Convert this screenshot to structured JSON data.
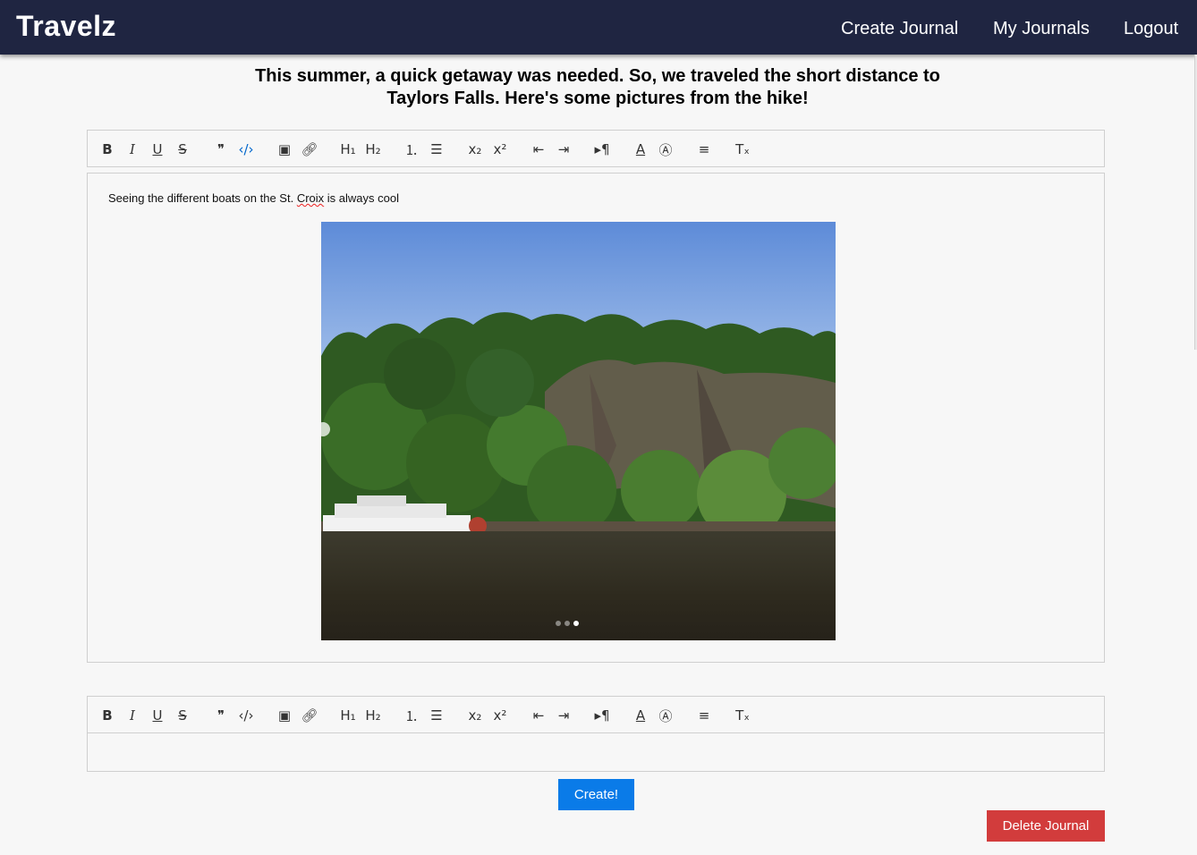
{
  "app": {
    "brand": "Travelz"
  },
  "nav": {
    "create": "Create Journal",
    "my_journals": "My Journals",
    "logout": "Logout"
  },
  "journal": {
    "intro": "This summer, a quick getaway was needed. So, we traveled the short distance to Taylors Falls. Here's some pictures from the hike!",
    "entry_text_before": "Seeing the different boats on the St. ",
    "entry_text_misspelled": "Croix",
    "entry_text_after": " is always cool",
    "image_alt": "Riverboat on the St. Croix below a rocky cliff",
    "carousel_slides": 3,
    "carousel_active": 3
  },
  "toolbar": {
    "bold": "B",
    "italic": "I",
    "underline": "U",
    "strike": "S",
    "quote": "❞",
    "code": "</>",
    "image": "image-icon",
    "link": "link-icon",
    "h1": "H1",
    "h2": "H2",
    "ordered_list": "ordered-list-icon",
    "bullet_list": "bullet-list-icon",
    "subscript": "subscript-icon",
    "superscript": "superscript-icon",
    "outdent": "outdent-icon",
    "indent": "indent-icon",
    "direction": "text-direction-icon",
    "color": "text-color-icon",
    "background": "background-color-icon",
    "align": "align-icon",
    "clean": "clear-format-icon"
  },
  "actions": {
    "create": "Create!",
    "delete": "Delete Journal"
  },
  "colors": {
    "navbar": "#1f2541",
    "primary": "#0a7be8",
    "danger": "#d23c3c",
    "active_tool": "#0066cc"
  }
}
